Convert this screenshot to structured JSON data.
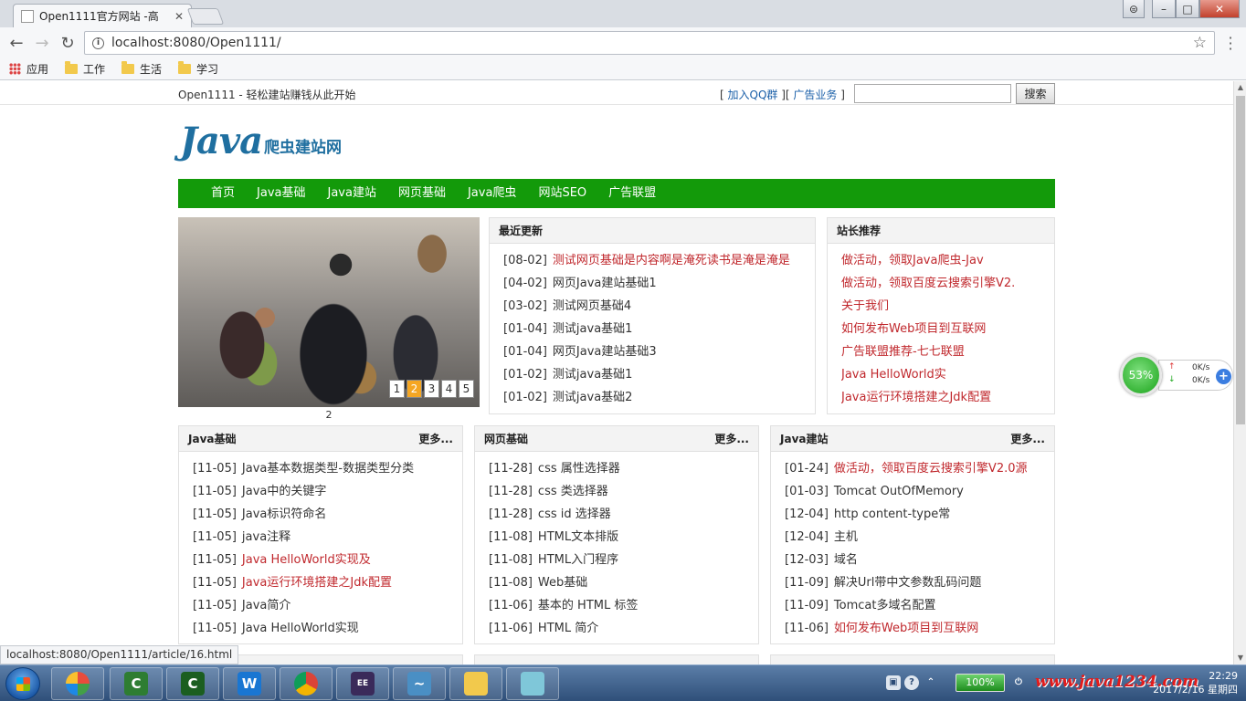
{
  "browser": {
    "tab_title": "Open1111官方网站 -高",
    "url": "localhost:8080/Open1111/",
    "bookmarks": [
      {
        "label": "应用",
        "icon": "apps-icon"
      },
      {
        "label": "工作",
        "icon": "folder-icon"
      },
      {
        "label": "生活",
        "icon": "folder-icon"
      },
      {
        "label": "学习",
        "icon": "folder-icon"
      }
    ]
  },
  "site": {
    "slogan": "Open1111 - 轻松建站赚钱从此开始",
    "toplinks": {
      "open": "[ ",
      "qq": "加入QQ群",
      "mid": " ][ ",
      "ad": "广告业务",
      "close": " ]"
    },
    "search_button": "搜索",
    "logo_main": "Java",
    "logo_sub": "爬虫建站网",
    "nav": [
      "首页",
      "Java基础",
      "Java建站",
      "网页基础",
      "Java爬虫",
      "网站SEO",
      "广告联盟"
    ]
  },
  "slider": {
    "pages": [
      "1",
      "2",
      "3",
      "4",
      "5"
    ],
    "active_page": "2",
    "caption": "2"
  },
  "latest": {
    "title": "最近更新",
    "items": [
      {
        "date": "[08-02]",
        "title": "测试网页基础是内容啊是淹死读书是淹是淹是",
        "red": true
      },
      {
        "date": "[04-02]",
        "title": "网页Java建站基础1",
        "red": false
      },
      {
        "date": "[03-02]",
        "title": "测试网页基础4",
        "red": false
      },
      {
        "date": "[01-04]",
        "title": "测试java基础1",
        "red": false
      },
      {
        "date": "[01-04]",
        "title": "网页Java建站基础3",
        "red": false
      },
      {
        "date": "[01-02]",
        "title": "测试java基础1",
        "red": false
      },
      {
        "date": "[01-02]",
        "title": "测试java基础2",
        "red": false
      }
    ]
  },
  "recommend": {
    "title": "站长推荐",
    "items": [
      "做活动，领取Java爬虫-Jav",
      "做活动，领取百度云搜索引擎V2.",
      "关于我们",
      "如何发布Web项目到互联网",
      "广告联盟推荐-七七联盟",
      "Java HelloWorld实",
      "Java运行环境搭建之Jdk配置"
    ]
  },
  "sections": [
    {
      "title": "Java基础",
      "more": "更多...",
      "items": [
        {
          "date": "[11-05]",
          "title": "Java基本数据类型-数据类型分类",
          "red": false
        },
        {
          "date": "[11-05]",
          "title": "Java中的关键字",
          "red": false
        },
        {
          "date": "[11-05]",
          "title": "Java标识符命名",
          "red": false
        },
        {
          "date": "[11-05]",
          "title": "java注释",
          "red": false
        },
        {
          "date": "[11-05]",
          "title": "Java HelloWorld实现及",
          "red": true
        },
        {
          "date": "[11-05]",
          "title": "Java运行环境搭建之Jdk配置",
          "red": true
        },
        {
          "date": "[11-05]",
          "title": "Java简介",
          "red": false
        },
        {
          "date": "[11-05]",
          "title": "Java HelloWorld实现",
          "red": false
        }
      ]
    },
    {
      "title": "网页基础",
      "more": "更多...",
      "items": [
        {
          "date": "[11-28]",
          "title": "css 属性选择器",
          "red": false
        },
        {
          "date": "[11-28]",
          "title": "css 类选择器",
          "red": false
        },
        {
          "date": "[11-28]",
          "title": "css id 选择器",
          "red": false
        },
        {
          "date": "[11-08]",
          "title": "HTML文本排版",
          "red": false
        },
        {
          "date": "[11-08]",
          "title": "HTML入门程序",
          "red": false
        },
        {
          "date": "[11-08]",
          "title": "Web基础",
          "red": false
        },
        {
          "date": "[11-06]",
          "title": "基本的 HTML 标签",
          "red": false
        },
        {
          "date": "[11-06]",
          "title": "HTML 简介",
          "red": false
        }
      ]
    },
    {
      "title": "Java建站",
      "more": "更多...",
      "items": [
        {
          "date": "[01-24]",
          "title": "做活动，领取百度云搜索引擎V2.0源",
          "red": true
        },
        {
          "date": "[01-03]",
          "title": "Tomcat OutOfMemory",
          "red": false
        },
        {
          "date": "[12-04]",
          "title": "http content-type常",
          "red": false
        },
        {
          "date": "[12-04]",
          "title": "主机",
          "red": false
        },
        {
          "date": "[12-03]",
          "title": "域名",
          "red": false
        },
        {
          "date": "[11-09]",
          "title": "解决Url带中文参数乱码问题",
          "red": false
        },
        {
          "date": "[11-09]",
          "title": "Tomcat多域名配置",
          "red": false
        },
        {
          "date": "[11-06]",
          "title": "如何发布Web项目到互联网",
          "red": true
        }
      ]
    }
  ],
  "status_url": "localhost:8080/Open1111/article/16.html",
  "speed_widget": {
    "percent": "53%",
    "up": "0K/s",
    "down": "0K/s"
  },
  "taskbar": {
    "battery": "100%",
    "clock_time": "22:29",
    "clock_date": "2017/2/16 星期四",
    "watermark": "www.java1234.com",
    "apps": [
      "folder-icon-app",
      "camtasia-icon",
      "camtasia-recorder-icon",
      "wps-writer-icon",
      "chrome-icon",
      "javaee-ide-icon",
      "mysql-icon",
      "explorer-icon",
      "notepad-icon"
    ]
  },
  "colors": {
    "nav_green": "#139a0a",
    "link_red": "#c0282d",
    "logo_blue": "#1f6fa0"
  }
}
